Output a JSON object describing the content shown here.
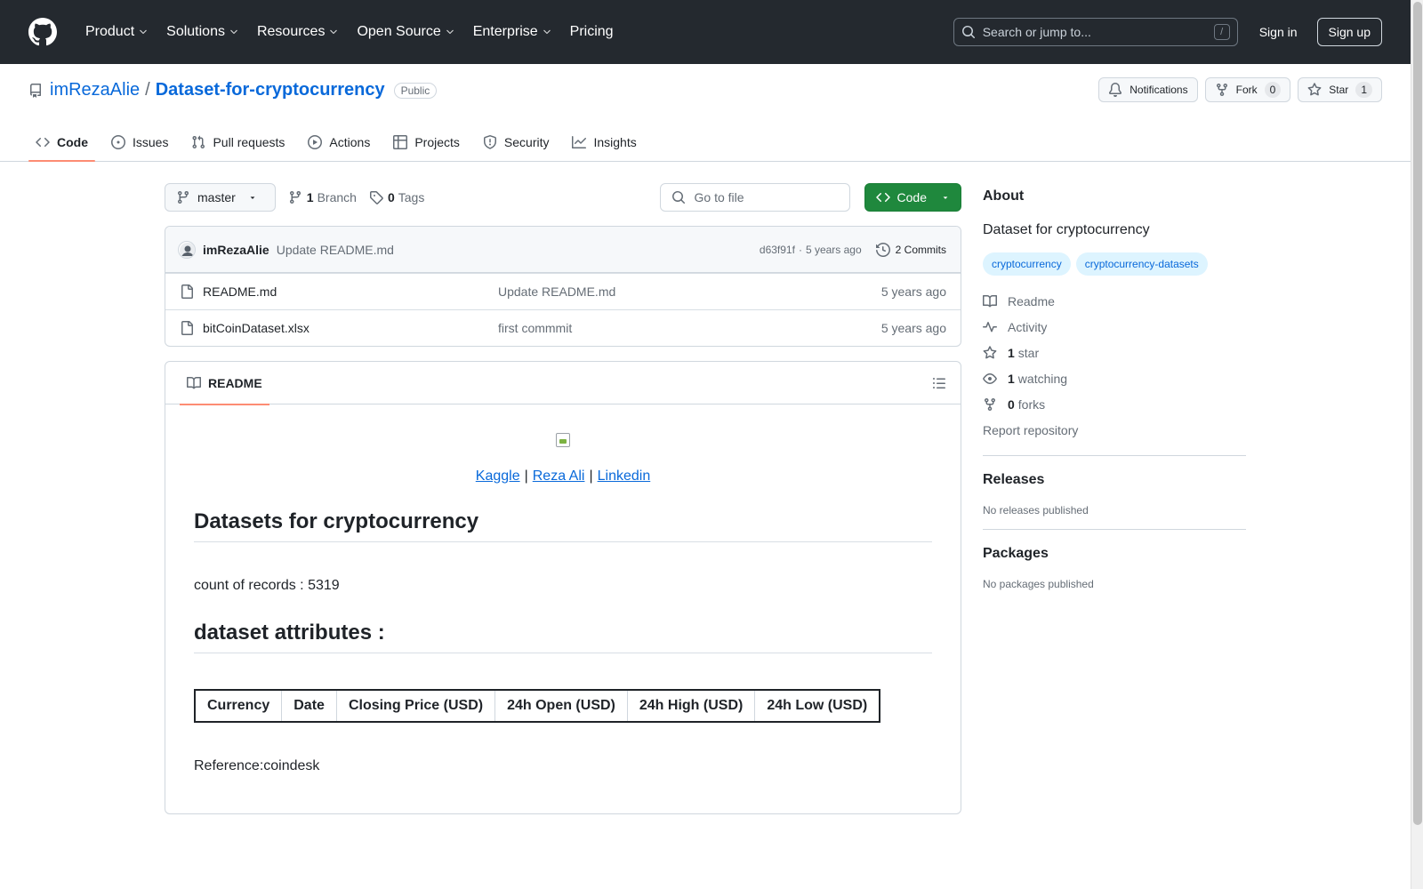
{
  "header": {
    "nav": [
      {
        "label": "Product",
        "dropdown": true
      },
      {
        "label": "Solutions",
        "dropdown": true
      },
      {
        "label": "Resources",
        "dropdown": true
      },
      {
        "label": "Open Source",
        "dropdown": true
      },
      {
        "label": "Enterprise",
        "dropdown": true
      },
      {
        "label": "Pricing",
        "dropdown": false
      }
    ],
    "search_placeholder": "Search or jump to...",
    "search_kbd": "/",
    "signin": "Sign in",
    "signup": "Sign up"
  },
  "repo": {
    "owner": "imRezaAlie",
    "separator": "/",
    "name": "Dataset-for-cryptocurrency",
    "visibility": "Public",
    "notifications_label": "Notifications",
    "fork_label": "Fork",
    "fork_count": "0",
    "star_label": "Star",
    "star_count": "1"
  },
  "tabs": [
    {
      "label": "Code",
      "icon": "code-icon",
      "active": true
    },
    {
      "label": "Issues",
      "icon": "issue-icon",
      "active": false
    },
    {
      "label": "Pull requests",
      "icon": "pull-request-icon",
      "active": false
    },
    {
      "label": "Actions",
      "icon": "play-icon",
      "active": false
    },
    {
      "label": "Projects",
      "icon": "table-icon",
      "active": false
    },
    {
      "label": "Security",
      "icon": "shield-icon",
      "active": false
    },
    {
      "label": "Insights",
      "icon": "graph-icon",
      "active": false
    }
  ],
  "toolbar": {
    "branch": "master",
    "branch_count": "1",
    "branch_label": "Branch",
    "tag_count": "0",
    "tag_label": "Tags",
    "goto_placeholder": "Go to file",
    "code_button": "Code"
  },
  "latest_commit": {
    "author": "imRezaAlie",
    "message": "Update README.md",
    "sha": "d63f91f",
    "dot": "·",
    "age": "5 years ago",
    "commits_label": "2 Commits"
  },
  "files": [
    {
      "name": "README.md",
      "commit": "Update README.md",
      "age": "5 years ago"
    },
    {
      "name": "bitCoinDataset.xlsx",
      "commit": "first commmit",
      "age": "5 years ago"
    }
  ],
  "readme": {
    "tab_label": "README",
    "links": [
      "Kaggle",
      "Reza Ali",
      "Linkedin"
    ],
    "link_sep": "|",
    "title": "Datasets for cryptocurrency",
    "records": "count of records : 5319",
    "attributes_heading": "dataset attributes :",
    "columns": [
      "Currency",
      "Date",
      "Closing Price (USD)",
      "24h Open (USD)",
      "24h High (USD)",
      "24h Low (USD)"
    ],
    "reference": "Reference:coindesk"
  },
  "sidebar": {
    "about_title": "About",
    "description": "Dataset for cryptocurrency",
    "topics": [
      "cryptocurrency",
      "cryptocurrency-datasets"
    ],
    "readme_label": "Readme",
    "activity_label": "Activity",
    "stars_count": "1",
    "stars_label": "star",
    "watching_count": "1",
    "watching_label": "watching",
    "forks_count": "0",
    "forks_label": "forks",
    "report": "Report repository",
    "releases_title": "Releases",
    "releases_text": "No releases published",
    "packages_title": "Packages",
    "packages_text": "No packages published"
  },
  "colors": {
    "header_bg": "#24292f",
    "link": "#0969da",
    "code_button": "#1f883d",
    "tab_underline": "#fd8c73",
    "topic_bg": "#ddf4ff"
  }
}
